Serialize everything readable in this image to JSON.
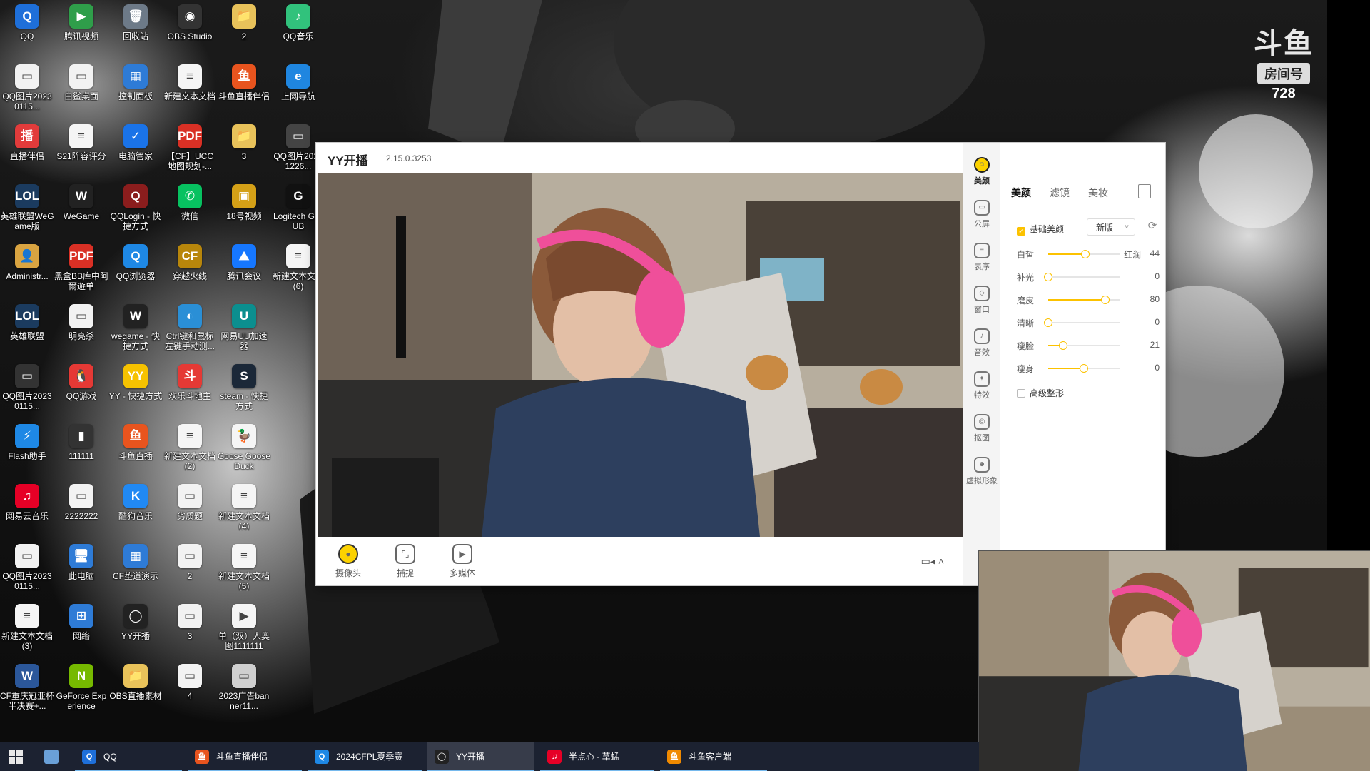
{
  "desktop": {
    "icons": [
      {
        "label": "QQ",
        "glyph": "Q",
        "color": "#1e6fd9"
      },
      {
        "label": "腾讯视频",
        "glyph": "▶",
        "color": "#2f9e4a"
      },
      {
        "label": "回收站",
        "glyph": "🗑",
        "color": "#6d7a88"
      },
      {
        "label": "OBS Studio",
        "glyph": "◉",
        "color": "#333333"
      },
      {
        "label": "2",
        "glyph": "📁",
        "color": "#e8c25a"
      },
      {
        "label": "QQ音乐",
        "glyph": "♪",
        "color": "#31c27c"
      },
      {
        "label": "QQ图片20230115...",
        "glyph": "▭",
        "color": "#f2f2f2"
      },
      {
        "label": "白鲨桌面",
        "glyph": "▭",
        "color": "#f2f2f2"
      },
      {
        "label": "控制面板",
        "glyph": "▦",
        "color": "#2e7bd6"
      },
      {
        "label": "新建文本文档",
        "glyph": "≡",
        "color": "#f5f5f5"
      },
      {
        "label": "斗鱼直播伴侣",
        "glyph": "鱼",
        "color": "#e8541e"
      },
      {
        "label": "上网导航",
        "glyph": "e",
        "color": "#1f86e0"
      },
      {
        "label": "直播伴侣",
        "glyph": "播",
        "color": "#e23b3b"
      },
      {
        "label": "S21阵容评分",
        "glyph": "≡",
        "color": "#f5f5f5"
      },
      {
        "label": "电脑管家",
        "glyph": "✓",
        "color": "#1a73e8"
      },
      {
        "label": "【CF】UCC地图规划-...",
        "glyph": "PDF",
        "color": "#d93025"
      },
      {
        "label": "3",
        "glyph": "📁",
        "color": "#e8c25a"
      },
      {
        "label": "QQ图片20221226...",
        "glyph": "▭",
        "color": "#444444"
      },
      {
        "label": "英雄联盟WeGame版",
        "glyph": "LOL",
        "color": "#1b3b5f"
      },
      {
        "label": "WeGame",
        "glyph": "W",
        "color": "#222222"
      },
      {
        "label": "QQLogin - 快捷方式",
        "glyph": "Q",
        "color": "#8b1d1d"
      },
      {
        "label": "微信",
        "glyph": "✆",
        "color": "#07c160"
      },
      {
        "label": "18号视频",
        "glyph": "▣",
        "color": "#d4a017"
      },
      {
        "label": "Logitech G HUB",
        "glyph": "G",
        "color": "#111111"
      },
      {
        "label": "Administr...",
        "glyph": "👤",
        "color": "#d9a441"
      },
      {
        "label": "黑盒BB库中阿爾遊单",
        "glyph": "PDF",
        "color": "#d93025"
      },
      {
        "label": "QQ浏览器",
        "glyph": "Q",
        "color": "#1e88e5"
      },
      {
        "label": "穿越火线",
        "glyph": "CF",
        "color": "#b8860b"
      },
      {
        "label": "腾讯会议",
        "glyph": "⛰",
        "color": "#1677ff"
      },
      {
        "label": "新建文本文档 (6)",
        "glyph": "≡",
        "color": "#f5f5f5"
      },
      {
        "label": "英雄联盟",
        "glyph": "LOL",
        "color": "#1b3b5f"
      },
      {
        "label": "明亮杀",
        "glyph": "▭",
        "color": "#f2f2f2"
      },
      {
        "label": "wegame - 快捷方式",
        "glyph": "W",
        "color": "#222222"
      },
      {
        "label": "Ctrl键和鼠标左键手动测...",
        "glyph": "◐",
        "color": "#2a8fd6"
      },
      {
        "label": "网易UU加速器",
        "glyph": "U",
        "color": "#0b8f8f"
      },
      {
        "label": "",
        "glyph": "",
        "color": "transparent"
      },
      {
        "label": "QQ图片20230115...",
        "glyph": "▭",
        "color": "#333333"
      },
      {
        "label": "QQ游戏",
        "glyph": "🐧",
        "color": "#e53935"
      },
      {
        "label": "YY - 快捷方式",
        "glyph": "YY",
        "color": "#f6c200"
      },
      {
        "label": "欢乐斗地主",
        "glyph": "斗",
        "color": "#e53935"
      },
      {
        "label": "steam - 快捷方式",
        "glyph": "S",
        "color": "#1b2838"
      },
      {
        "label": "",
        "glyph": "",
        "color": "transparent"
      },
      {
        "label": "Flash助手",
        "glyph": "⚡",
        "color": "#1e88e5"
      },
      {
        "label": "111111",
        "glyph": "▮",
        "color": "#333333"
      },
      {
        "label": "斗鱼直播",
        "glyph": "鱼",
        "color": "#e8541e"
      },
      {
        "label": "新建文本文档 (2)",
        "glyph": "≡",
        "color": "#f5f5f5"
      },
      {
        "label": "Goose Goose Duck",
        "glyph": "🦆",
        "color": "#f5f5f5"
      },
      {
        "label": "",
        "glyph": "",
        "color": "transparent"
      },
      {
        "label": "网易云音乐",
        "glyph": "♫",
        "color": "#e60026"
      },
      {
        "label": "2222222",
        "glyph": "▭",
        "color": "#f2f2f2"
      },
      {
        "label": "酷狗音乐",
        "glyph": "K",
        "color": "#2189f3"
      },
      {
        "label": "劣质题",
        "glyph": "▭",
        "color": "#f2f2f2"
      },
      {
        "label": "新建文本文档 (4)",
        "glyph": "≡",
        "color": "#f5f5f5"
      },
      {
        "label": "",
        "glyph": "",
        "color": "transparent"
      },
      {
        "label": "QQ图片20230115...",
        "glyph": "▭",
        "color": "#f2f2f2"
      },
      {
        "label": "此电脑",
        "glyph": "🖥",
        "color": "#2e7bd6"
      },
      {
        "label": "CF垫道演示",
        "glyph": "▦",
        "color": "#2e7bd6"
      },
      {
        "label": "2",
        "glyph": "▭",
        "color": "#f2f2f2"
      },
      {
        "label": "新建文本文档 (5)",
        "glyph": "≡",
        "color": "#f5f5f5"
      },
      {
        "label": "",
        "glyph": "",
        "color": "transparent"
      },
      {
        "label": "新建文本文档 (3)",
        "glyph": "≡",
        "color": "#f5f5f5"
      },
      {
        "label": "网络",
        "glyph": "⊞",
        "color": "#2e7bd6"
      },
      {
        "label": "YY开播",
        "glyph": "◯",
        "color": "#222222"
      },
      {
        "label": "3",
        "glyph": "▭",
        "color": "#f2f2f2"
      },
      {
        "label": "单（双）人奥图1111111",
        "glyph": "▶",
        "color": "#f5f5f5"
      },
      {
        "label": "",
        "glyph": "",
        "color": "transparent"
      },
      {
        "label": "CF重庆冠亚杯半决赛+...",
        "glyph": "W",
        "color": "#2b579a"
      },
      {
        "label": "GeForce Experience",
        "glyph": "N",
        "color": "#76b900"
      },
      {
        "label": "OBS直播素材",
        "glyph": "📁",
        "color": "#e8c25a"
      },
      {
        "label": "4",
        "glyph": "▭",
        "color": "#f2f2f2"
      },
      {
        "label": "2023广告banner11...",
        "glyph": "▭",
        "color": "#cfcfcf"
      },
      {
        "label": "",
        "glyph": "",
        "color": "transparent"
      }
    ]
  },
  "overlay": {
    "brand": "斗鱼",
    "room_label": "房间号",
    "room_number": "728"
  },
  "yy_window": {
    "title": "YY开播",
    "version": "2.15.0.3253",
    "controls": {
      "menu": "☰",
      "minimize": "—",
      "maximize": "☐",
      "close": "✕"
    },
    "bottom": {
      "camera": "摄像头",
      "capture": "捕捉",
      "media": "多媒体"
    },
    "side_tabs": [
      {
        "label": "美颜",
        "glyph": "☺"
      },
      {
        "label": "公屏",
        "glyph": "▭"
      },
      {
        "label": "表序",
        "glyph": "≡"
      },
      {
        "label": "窗口",
        "glyph": "◇"
      },
      {
        "label": "音效",
        "glyph": "♪"
      },
      {
        "label": "特效",
        "glyph": "✦"
      },
      {
        "label": "抠图",
        "glyph": "◎"
      },
      {
        "label": "虚拟形象",
        "glyph": "☻"
      }
    ],
    "panel": {
      "tabs": [
        "美颜",
        "滤镜",
        "美妆"
      ],
      "basic_beauty": "基础美颜",
      "version_select": "新版",
      "sliders": [
        {
          "name": "白皙",
          "value": 44,
          "extra": "红润"
        },
        {
          "name": "补光",
          "value": 0,
          "extra": ""
        },
        {
          "name": "磨皮",
          "value": 80,
          "extra": ""
        },
        {
          "name": "清晰",
          "value": 0,
          "extra": ""
        },
        {
          "name": "瘦脸",
          "value": 21,
          "extra": ""
        },
        {
          "name": "瘦身",
          "value": 0,
          "extra": ""
        }
      ],
      "slider_fill": [
        0.52,
        0.0,
        0.8,
        0.0,
        0.21,
        0.5
      ],
      "advanced": "高级整形"
    }
  },
  "taskbar": {
    "items": [
      {
        "label": "QQ",
        "glyph": "Q",
        "color": "#1e6fd9"
      },
      {
        "label": "斗鱼直播伴侣",
        "glyph": "鱼",
        "color": "#e8541e"
      },
      {
        "label": "2024CFPL夏季赛",
        "glyph": "Q",
        "color": "#1e88e5"
      },
      {
        "label": "YY开播",
        "glyph": "◯",
        "color": "#222222"
      },
      {
        "label": "半点心 - 草蜢",
        "glyph": "♫",
        "color": "#e60026"
      },
      {
        "label": "斗鱼客户端",
        "glyph": "鱼",
        "color": "#f08a00"
      }
    ]
  },
  "colors": {
    "accent": "#fcc200",
    "taskbar": "#1c2231"
  }
}
